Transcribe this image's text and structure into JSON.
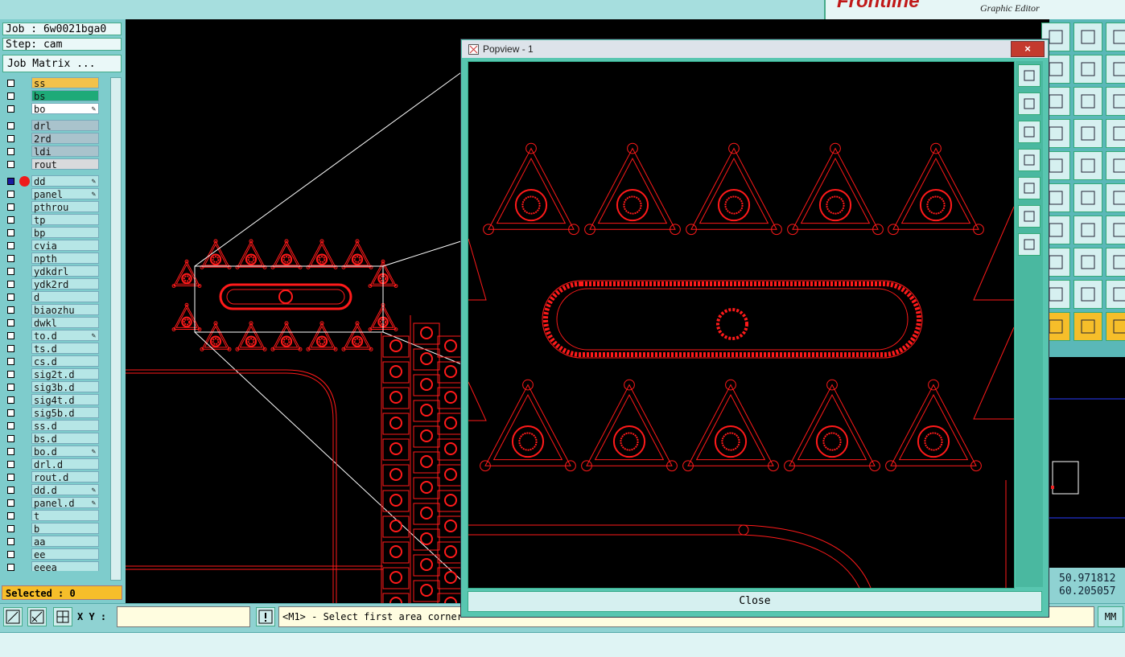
{
  "app": {
    "brand": "Frontline",
    "subtitle": "Graphic Editor"
  },
  "left_panel": {
    "job_label": "Job : 6w0021bga0",
    "step_label": "Step: cam",
    "job_matrix_button": "Job Matrix ...",
    "selected_label": "Selected : 0",
    "layers": [
      {
        "name": "ss",
        "color": "#f2c24b"
      },
      {
        "name": "bs",
        "color": "#1eaa78"
      },
      {
        "name": "bo",
        "color": "#ffffff",
        "mark": "edit-icon"
      },
      {
        "name": "drl",
        "color": "#a9c3cc"
      },
      {
        "name": "2rd",
        "color": "#a9c3cc"
      },
      {
        "name": "ldi",
        "color": "#a9c3cc"
      },
      {
        "name": "rout",
        "color": "#d8dadc"
      },
      {
        "name": "dd",
        "color": "#b6e6e6",
        "active": true,
        "mark": "edit-icon"
      },
      {
        "name": "panel",
        "color": "#b6e6e6",
        "mark": "edit-icon"
      },
      {
        "name": "pthrou",
        "color": "#b6e6e6"
      },
      {
        "name": "tp",
        "color": "#b6e6e6"
      },
      {
        "name": "bp",
        "color": "#b6e6e6"
      },
      {
        "name": "cvia",
        "color": "#b6e6e6"
      },
      {
        "name": "npth",
        "color": "#b6e6e6"
      },
      {
        "name": "ydkdrl",
        "color": "#b6e6e6"
      },
      {
        "name": "ydk2rd",
        "color": "#b6e6e6"
      },
      {
        "name": "d",
        "color": "#b6e6e6"
      },
      {
        "name": "biaozhu",
        "color": "#b6e6e6"
      },
      {
        "name": "dwkl",
        "color": "#b6e6e6"
      },
      {
        "name": "to.d",
        "color": "#b6e6e6",
        "mark": "edit-icon"
      },
      {
        "name": "ts.d",
        "color": "#b6e6e6"
      },
      {
        "name": "cs.d",
        "color": "#b6e6e6"
      },
      {
        "name": "sig2t.d",
        "color": "#b6e6e6"
      },
      {
        "name": "sig3b.d",
        "color": "#b6e6e6"
      },
      {
        "name": "sig4t.d",
        "color": "#b6e6e6"
      },
      {
        "name": "sig5b.d",
        "color": "#b6e6e6"
      },
      {
        "name": "ss.d",
        "color": "#b6e6e6"
      },
      {
        "name": "bs.d",
        "color": "#b6e6e6"
      },
      {
        "name": "bo.d",
        "color": "#b6e6e6",
        "mark": "edit-icon"
      },
      {
        "name": "drl.d",
        "color": "#b6e6e6"
      },
      {
        "name": "rout.d",
        "color": "#b6e6e6"
      },
      {
        "name": "dd.d",
        "color": "#b6e6e6",
        "mark": "edit-icon"
      },
      {
        "name": "panel.d",
        "color": "#b6e6e6",
        "mark": "edit-icon"
      },
      {
        "name": "t",
        "color": "#b6e6e6"
      },
      {
        "name": "b",
        "color": "#b6e6e6"
      },
      {
        "name": "aa",
        "color": "#b6e6e6"
      },
      {
        "name": "ee",
        "color": "#b6e6e6"
      },
      {
        "name": "eeea",
        "color": "#b6e6e6"
      }
    ]
  },
  "status": {
    "xy_label": "X Y :",
    "xy_value": "",
    "prompt": "<M1> - Select first area corner",
    "units": "MM"
  },
  "coords": {
    "x": "50.971812",
    "y": "60.205057"
  },
  "popup": {
    "title": "Popview - 1",
    "close_glyph": "×",
    "close_button": "Close"
  },
  "colors": {
    "feature": "#ff1a1a",
    "panel_bg": "#8fd2d2",
    "canvas_bg": "#000000"
  }
}
